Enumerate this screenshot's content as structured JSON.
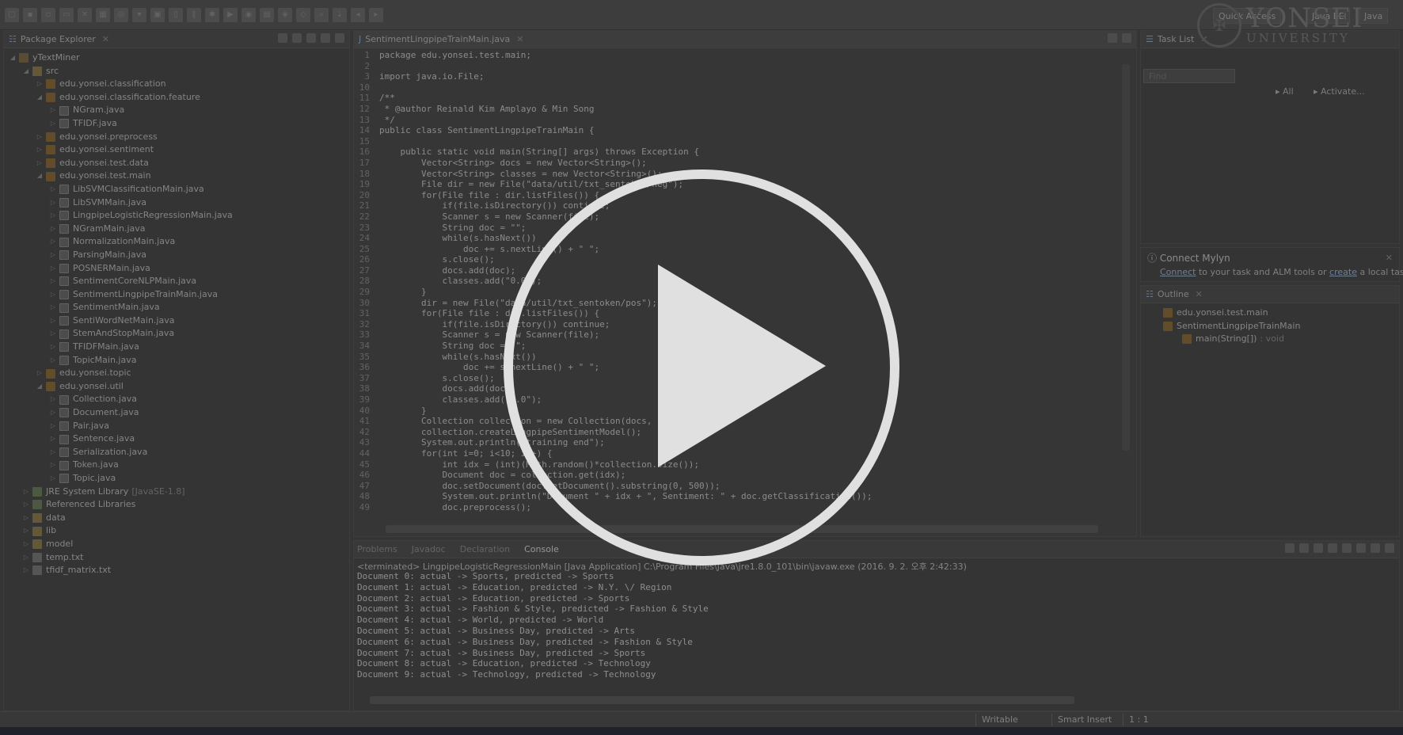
{
  "logo": {
    "line1": "YONSEI",
    "line2": "UNIVERSITY"
  },
  "toolbar": {
    "perspectives": [
      "Quick Access",
      "Java EE",
      "Java"
    ]
  },
  "package_explorer": {
    "title": "Package Explorer",
    "tree": [
      {
        "label": "yTextMiner",
        "type": "proj",
        "depth": 0,
        "expanded": true
      },
      {
        "label": "src",
        "type": "folder",
        "depth": 1,
        "expanded": true
      },
      {
        "label": "edu.yonsei.classification",
        "type": "pkg",
        "depth": 2,
        "expanded": false
      },
      {
        "label": "edu.yonsei.classification.feature",
        "type": "pkg",
        "depth": 2,
        "expanded": true
      },
      {
        "label": "NGram.java",
        "type": "java",
        "depth": 3,
        "expanded": false
      },
      {
        "label": "TFIDF.java",
        "type": "java",
        "depth": 3,
        "expanded": false
      },
      {
        "label": "edu.yonsei.preprocess",
        "type": "pkg",
        "depth": 2,
        "expanded": false
      },
      {
        "label": "edu.yonsei.sentiment",
        "type": "pkg",
        "depth": 2,
        "expanded": false
      },
      {
        "label": "edu.yonsei.test.data",
        "type": "pkg",
        "depth": 2,
        "expanded": false
      },
      {
        "label": "edu.yonsei.test.main",
        "type": "pkg",
        "depth": 2,
        "expanded": true
      },
      {
        "label": "LibSVMClassificationMain.java",
        "type": "java",
        "depth": 3,
        "expanded": false
      },
      {
        "label": "LibSVMMain.java",
        "type": "java",
        "depth": 3,
        "expanded": false
      },
      {
        "label": "LingpipeLogisticRegressionMain.java",
        "type": "java",
        "depth": 3,
        "expanded": false
      },
      {
        "label": "NGramMain.java",
        "type": "java",
        "depth": 3,
        "expanded": false
      },
      {
        "label": "NormalizationMain.java",
        "type": "java",
        "depth": 3,
        "expanded": false
      },
      {
        "label": "ParsingMain.java",
        "type": "java",
        "depth": 3,
        "expanded": false
      },
      {
        "label": "POSNERMain.java",
        "type": "java",
        "depth": 3,
        "expanded": false
      },
      {
        "label": "SentimentCoreNLPMain.java",
        "type": "java",
        "depth": 3,
        "expanded": false
      },
      {
        "label": "SentimentLingpipeTrainMain.java",
        "type": "java",
        "depth": 3,
        "expanded": false
      },
      {
        "label": "SentimentMain.java",
        "type": "java",
        "depth": 3,
        "expanded": false
      },
      {
        "label": "SentiWordNetMain.java",
        "type": "java",
        "depth": 3,
        "expanded": false
      },
      {
        "label": "StemAndStopMain.java",
        "type": "java",
        "depth": 3,
        "expanded": false
      },
      {
        "label": "TFIDFMain.java",
        "type": "java",
        "depth": 3,
        "expanded": false
      },
      {
        "label": "TopicMain.java",
        "type": "java",
        "depth": 3,
        "expanded": false
      },
      {
        "label": "edu.yonsei.topic",
        "type": "pkg",
        "depth": 2,
        "expanded": false
      },
      {
        "label": "edu.yonsei.util",
        "type": "pkg",
        "depth": 2,
        "expanded": true
      },
      {
        "label": "Collection.java",
        "type": "java",
        "depth": 3,
        "expanded": false
      },
      {
        "label": "Document.java",
        "type": "java",
        "depth": 3,
        "expanded": false
      },
      {
        "label": "Pair.java",
        "type": "java",
        "depth": 3,
        "expanded": false
      },
      {
        "label": "Sentence.java",
        "type": "java",
        "depth": 3,
        "expanded": false
      },
      {
        "label": "Serialization.java",
        "type": "java",
        "depth": 3,
        "expanded": false
      },
      {
        "label": "Token.java",
        "type": "java",
        "depth": 3,
        "expanded": false
      },
      {
        "label": "Topic.java",
        "type": "java",
        "depth": 3,
        "expanded": false
      },
      {
        "label": "JRE System Library",
        "suffix": "[JavaSE-1.8]",
        "type": "lib",
        "depth": 1,
        "expanded": false
      },
      {
        "label": "Referenced Libraries",
        "type": "lib",
        "depth": 1,
        "expanded": false
      },
      {
        "label": "data",
        "type": "folder",
        "depth": 1,
        "expanded": false
      },
      {
        "label": "lib",
        "type": "folder",
        "depth": 1,
        "expanded": false
      },
      {
        "label": "model",
        "type": "folder",
        "depth": 1,
        "expanded": false
      },
      {
        "label": "temp.txt",
        "type": "file",
        "depth": 1,
        "expanded": false
      },
      {
        "label": "tfidf_matrix.txt",
        "type": "file",
        "depth": 1,
        "expanded": false
      }
    ]
  },
  "editor": {
    "tab": "SentimentLingpipeTrainMain.java",
    "lines": [
      {
        "n": "1",
        "text": "package edu.yonsei.test.main;"
      },
      {
        "n": "2",
        "text": ""
      },
      {
        "n": "3",
        "text": "import java.io.File;"
      },
      {
        "n": "10",
        "text": ""
      },
      {
        "n": "11",
        "text": "/**"
      },
      {
        "n": "12",
        "text": " * @author Reinald Kim Amplayo & Min Song"
      },
      {
        "n": "13",
        "text": " */"
      },
      {
        "n": "14",
        "text": "public class SentimentLingpipeTrainMain {"
      },
      {
        "n": "15",
        "text": ""
      },
      {
        "n": "16",
        "text": "    public static void main(String[] args) throws Exception {"
      },
      {
        "n": "17",
        "text": "        Vector<String> docs = new Vector<String>();"
      },
      {
        "n": "18",
        "text": "        Vector<String> classes = new Vector<String>();"
      },
      {
        "n": "19",
        "text": "        File dir = new File(\"data/util/txt_sentoken/neg\");"
      },
      {
        "n": "20",
        "text": "        for(File file : dir.listFiles()) {"
      },
      {
        "n": "21",
        "text": "            if(file.isDirectory()) continue;"
      },
      {
        "n": "22",
        "text": "            Scanner s = new Scanner(file);"
      },
      {
        "n": "23",
        "text": "            String doc = \"\";"
      },
      {
        "n": "24",
        "text": "            while(s.hasNext())"
      },
      {
        "n": "25",
        "text": "                doc += s.nextLine() + \" \";"
      },
      {
        "n": "26",
        "text": "            s.close();"
      },
      {
        "n": "27",
        "text": "            docs.add(doc);"
      },
      {
        "n": "28",
        "text": "            classes.add(\"0.0\");"
      },
      {
        "n": "29",
        "text": "        }"
      },
      {
        "n": "30",
        "text": "        dir = new File(\"data/util/txt_sentoken/pos\");"
      },
      {
        "n": "31",
        "text": "        for(File file : dir.listFiles()) {"
      },
      {
        "n": "32",
        "text": "            if(file.isDirectory()) continue;"
      },
      {
        "n": "33",
        "text": "            Scanner s = new Scanner(file);"
      },
      {
        "n": "34",
        "text": "            String doc = \"\";"
      },
      {
        "n": "35",
        "text": "            while(s.hasNext())"
      },
      {
        "n": "36",
        "text": "                doc += s.nextLine() + \" \";"
      },
      {
        "n": "37",
        "text": "            s.close();"
      },
      {
        "n": "38",
        "text": "            docs.add(doc);"
      },
      {
        "n": "39",
        "text": "            classes.add(\"1.0\");"
      },
      {
        "n": "40",
        "text": "        }"
      },
      {
        "n": "41",
        "text": "        Collection collection = new Collection(docs, classes);"
      },
      {
        "n": "42",
        "text": "        collection.createLingpipeSentimentModel();"
      },
      {
        "n": "43",
        "text": "        System.out.println(\"training end\");"
      },
      {
        "n": "44",
        "text": "        for(int i=0; i<10; i++) {"
      },
      {
        "n": "45",
        "text": "            int idx = (int)(Math.random()*collection.size());"
      },
      {
        "n": "46",
        "text": "            Document doc = collection.get(idx);"
      },
      {
        "n": "47",
        "text": "            doc.setDocument(doc.getDocument().substring(0, 500));"
      },
      {
        "n": "48",
        "text": "            System.out.println(\"Document \" + idx + \", Sentiment: \" + doc.getClassification());"
      },
      {
        "n": "49",
        "text": "            doc.preprocess();"
      }
    ]
  },
  "task_list": {
    "title": "Task List",
    "find_placeholder": "Find",
    "all": "All",
    "activate": "Activate..."
  },
  "mylyn": {
    "title": "Connect Mylyn",
    "text_connect": "Connect",
    "text_mid": " to your task and ALM tools or ",
    "text_create": "create",
    "text_end": " a local task."
  },
  "outline": {
    "title": "Outline",
    "items": [
      {
        "label": "edu.yonsei.test.main",
        "depth": 0
      },
      {
        "label": "SentimentLingpipeTrainMain",
        "depth": 0
      },
      {
        "label": "main(String[])",
        "suffix": ": void",
        "depth": 1
      }
    ]
  },
  "bottom_tabs": [
    "Problems",
    "Javadoc",
    "Declaration",
    "Console"
  ],
  "console": {
    "header": "<terminated> LingpipeLogisticRegressionMain [Java Application] C:\\Program Files\\Java\\jre1.8.0_101\\bin\\javaw.exe (2016. 9. 2. 오후 2:42:33)",
    "lines": [
      "Document 0: actual -> Sports, predicted -> Sports",
      "Document 1: actual -> Education, predicted -> N.Y. \\/ Region",
      "Document 2: actual -> Education, predicted -> Sports",
      "Document 3: actual -> Fashion & Style, predicted -> Fashion & Style",
      "Document 4: actual -> World, predicted -> World",
      "Document 5: actual -> Business Day, predicted -> Arts",
      "Document 6: actual -> Business Day, predicted -> Fashion & Style",
      "Document 7: actual -> Business Day, predicted -> Sports",
      "Document 8: actual -> Education, predicted -> Technology",
      "Document 9: actual -> Technology, predicted -> Technology"
    ]
  },
  "status": {
    "writable": "Writable",
    "insert": "Smart Insert",
    "position": "1 : 1"
  }
}
